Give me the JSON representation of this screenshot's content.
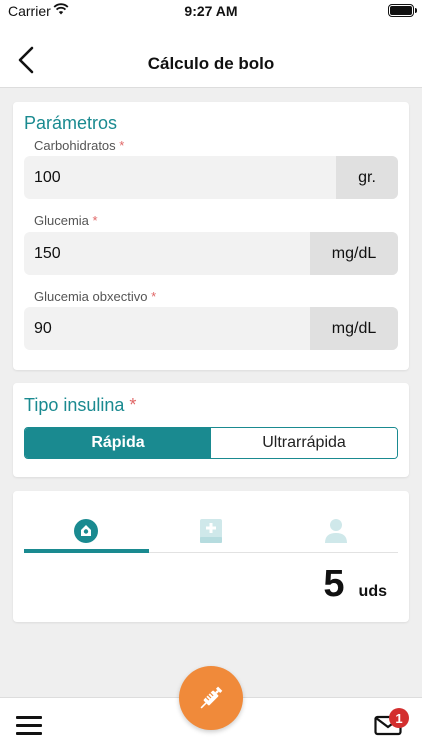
{
  "status_bar": {
    "carrier": "Carrier",
    "time": "9:27 AM"
  },
  "header": {
    "title": "Cálculo de bolo",
    "back_icon": "chevron-left-icon"
  },
  "parameters": {
    "title": "Parámetros",
    "fields": [
      {
        "label": "Carbohidratos",
        "required_mark": "*",
        "value": "100",
        "unit": "gr."
      },
      {
        "label": "Glucemia",
        "required_mark": "*",
        "value": "150",
        "unit": "mg/dL"
      },
      {
        "label": "Glucemia obxectivo",
        "required_mark": "*",
        "value": "90",
        "unit": "mg/dL"
      }
    ]
  },
  "insulin_type": {
    "title": "Tipo insulina",
    "required_mark": "*",
    "options": [
      "Rápida",
      "Ultrarrápida"
    ],
    "selected": "Rápida"
  },
  "result_tabs": {
    "tabs": [
      {
        "icon": "food-icon",
        "active": true
      },
      {
        "icon": "medical-book-icon",
        "active": false
      },
      {
        "icon": "user-icon",
        "active": false
      }
    ],
    "result_value": "5",
    "result_unit": "uds"
  },
  "bottom_bar": {
    "menu_icon": "hamburger-menu-icon",
    "fab_icon": "syringe-icon",
    "mail_icon": "mail-icon",
    "notification_count": "1"
  },
  "colors": {
    "accent": "#1a8a90",
    "fab": "#f08a3a",
    "badge": "#d32f2f",
    "required": "#e06666"
  }
}
